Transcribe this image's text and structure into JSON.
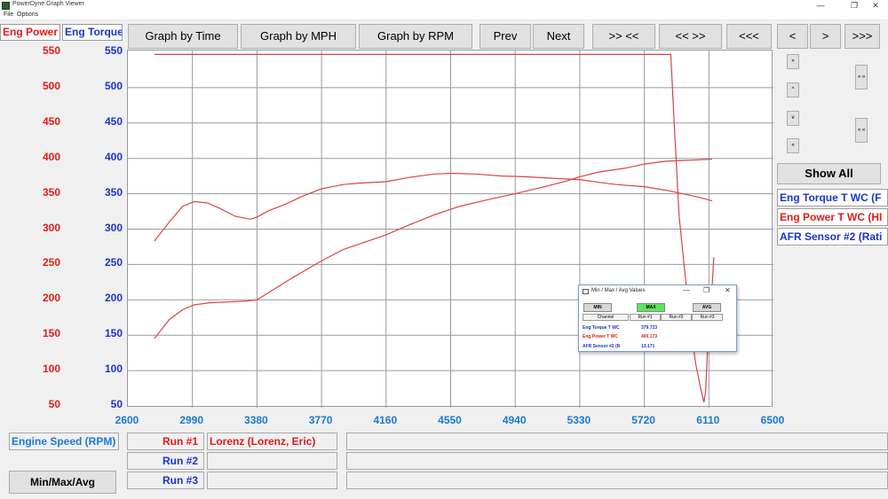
{
  "window": {
    "title": "PowerDyne Graph Viewer",
    "minimize": "—",
    "restore": "❐",
    "close": "✕"
  },
  "menu": {
    "file": "File",
    "options": "Options"
  },
  "selectors": {
    "power": "Eng Power",
    "torque": "Eng Torque"
  },
  "toolbar": {
    "graph_time": "Graph by Time",
    "graph_mph": "Graph by MPH",
    "graph_rpm": "Graph by RPM",
    "prev": "Prev",
    "next": "Next",
    "zoom_in": ">> <<",
    "zoom_out": "<< >>",
    "scroll_far_left": "<<<",
    "scroll_left": "<",
    "scroll_right": ">",
    "scroll_far_right": ">>>"
  },
  "side_buttons": {
    "b1": "»",
    "b2": "^",
    "b3": "v",
    "b4": "«",
    "b5": "» »",
    "b6": "« «"
  },
  "legend": {
    "show_all": "Show All",
    "items": [
      "Eng Torque T WC (F",
      "Eng Power T WC (HI",
      "AFR Sensor #2 (Rati"
    ]
  },
  "bottom": {
    "x_axis_name": "Engine Speed (RPM)",
    "run1": "Run #1",
    "run2": "Run #2",
    "run3": "Run #3",
    "run1_name": "Lorenz (Lorenz, Eric)",
    "minmax_button": "Min/Max/Avg"
  },
  "popup": {
    "title": "Min / Max / Avg Values",
    "min": "MIN",
    "max": "MAX",
    "avg": "AVG",
    "headers": [
      "Channel",
      "Run #1",
      "Run #2",
      "Run #3"
    ],
    "rows": [
      {
        "channel": "Eng Torque T WC",
        "run1": "379.723"
      },
      {
        "channel": "Eng Power T WC",
        "run1": "400.173"
      },
      {
        "channel": "AFR Sensor #2 (R",
        "run1": "13.171"
      }
    ]
  },
  "colors": {
    "red": "#e01b1b",
    "blue": "#1a35c8",
    "axis_blue": "#1a7ad1",
    "trace": "#d84444",
    "grid": "#9a9a9a",
    "max_green": "#5ce65c"
  },
  "chart_data": {
    "type": "line",
    "xlabel": "Engine Speed (RPM)",
    "x_ticks": [
      2600,
      2990,
      3380,
      3770,
      4160,
      4550,
      4940,
      5330,
      5720,
      6110,
      6500
    ],
    "xlim": [
      2600,
      6500
    ],
    "y_ticks": [
      50,
      100,
      150,
      200,
      250,
      300,
      350,
      400,
      450,
      500,
      550
    ],
    "ylim": [
      50,
      550
    ],
    "grid": true,
    "series": [
      {
        "name": "Eng Torque T WC",
        "x": [
          2760,
          2850,
          2930,
          3000,
          3080,
          3150,
          3250,
          3340,
          3380,
          3450,
          3550,
          3650,
          3770,
          3900,
          4000,
          4160,
          4300,
          4450,
          4550,
          4700,
          4860,
          5000,
          5150,
          5330,
          5450,
          5550,
          5720,
          5850,
          5950,
          6050,
          6130
        ],
        "y": [
          283,
          310,
          332,
          339,
          337,
          330,
          318,
          314,
          317,
          326,
          335,
          346,
          357,
          363,
          365,
          367,
          373,
          378,
          379,
          378,
          375,
          374,
          372,
          370,
          366,
          363,
          360,
          355,
          350,
          345,
          340
        ]
      },
      {
        "name": "Eng Power T WC",
        "x": [
          2760,
          2850,
          2930,
          3000,
          3100,
          3200,
          3300,
          3380,
          3450,
          3600,
          3770,
          3900,
          4050,
          4160,
          4300,
          4450,
          4600,
          4800,
          4940,
          5100,
          5250,
          5330,
          5450,
          5600,
          5720,
          5850,
          5950,
          6050,
          6130
        ],
        "y": [
          145,
          172,
          186,
          193,
          196,
          197,
          198,
          200,
          210,
          232,
          255,
          271,
          283,
          292,
          306,
          320,
          332,
          343,
          350,
          359,
          368,
          374,
          381,
          386,
          392,
          396,
          397,
          398,
          399
        ]
      },
      {
        "name": "AFR Sensor #2",
        "x": [
          2760,
          3400,
          4000,
          4800,
          5500,
          5880,
          5900,
          5930,
          5960,
          6000,
          6030,
          6060,
          6080,
          6090,
          6100,
          6110,
          6120,
          6130,
          6140
        ],
        "y": [
          547,
          547,
          547,
          547,
          547,
          547,
          450,
          320,
          250,
          160,
          110,
          75,
          55,
          70,
          120,
          200,
          150,
          220,
          260
        ]
      }
    ]
  }
}
